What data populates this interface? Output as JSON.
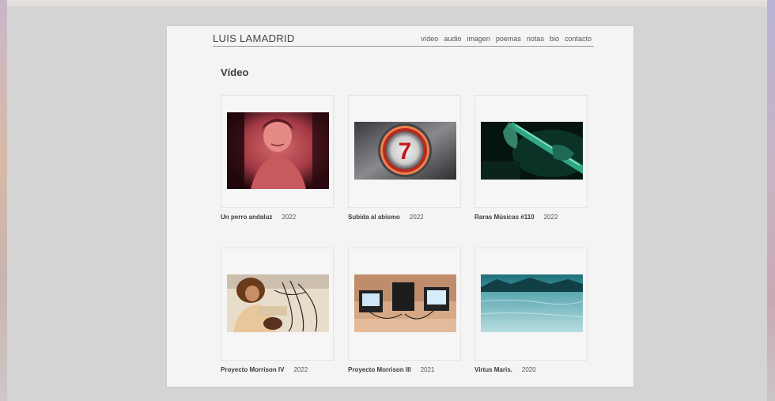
{
  "site": {
    "title": "LUIS LAMADRID"
  },
  "nav": [
    "vídeo",
    "audio",
    "imagen",
    "poemas",
    "notas",
    "bio",
    "contacto"
  ],
  "section": {
    "title": "Vídeo"
  },
  "videos": [
    {
      "title": "Un perro andaluz",
      "year": "2022",
      "thumb_icon": "woman-portrait-red-thumbnail"
    },
    {
      "title": "Subida al abismo",
      "year": "2022",
      "thumb_icon": "elevator-button-7-thumbnail"
    },
    {
      "title": "Raras Músicas #110",
      "year": "2022",
      "thumb_icon": "guitar-green-thumbnail"
    },
    {
      "title": "Proyecto Morrison IV",
      "year": "2022",
      "thumb_icon": "performer-cables-thumbnail"
    },
    {
      "title": "Proyecto Morrison III",
      "year": "2021",
      "thumb_icon": "crt-monitors-thumbnail"
    },
    {
      "title": "Virtus Maris.",
      "year": "2020",
      "thumb_icon": "lake-landscape-thumbnail"
    }
  ],
  "thumb_numeral": "7"
}
